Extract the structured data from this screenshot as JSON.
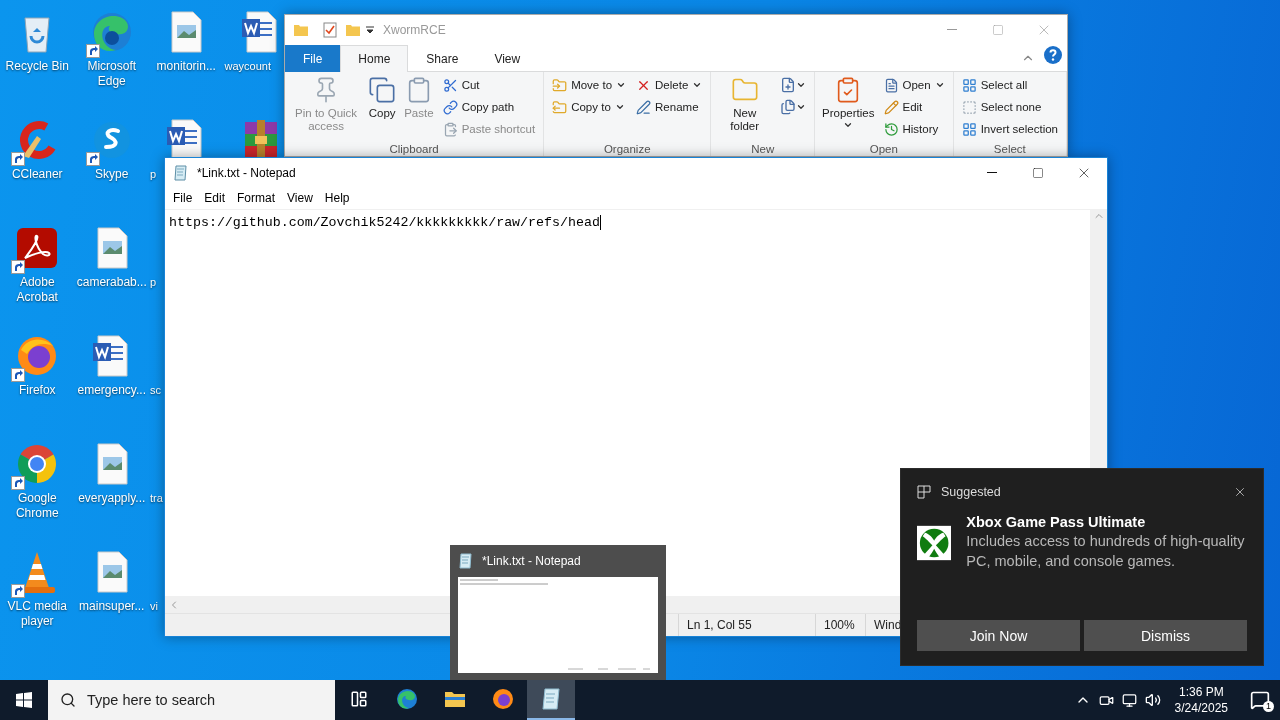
{
  "desktop_icons": [
    {
      "label": "Recycle Bin",
      "shortcut": false,
      "icon": true,
      "clipped": false
    },
    {
      "label": "CCleaner",
      "shortcut": true,
      "icon": true,
      "clipped": false
    },
    {
      "label": "Adobe Acrobat",
      "shortcut": true,
      "icon": true,
      "clipped": false
    },
    {
      "label": "Firefox",
      "shortcut": true,
      "icon": true,
      "clipped": false
    },
    {
      "label": "Google Chrome",
      "shortcut": true,
      "icon": true,
      "clipped": false
    },
    {
      "label": "VLC media player",
      "shortcut": true,
      "icon": true,
      "clipped": false
    },
    {
      "label": "Microsoft Edge",
      "shortcut": true,
      "icon": true,
      "clipped": false
    },
    {
      "label": "Skype",
      "shortcut": true,
      "icon": true,
      "clipped": false
    },
    {
      "label": "camerabab...",
      "shortcut": false,
      "icon": true,
      "clipped": false
    },
    {
      "label": "emergency...",
      "shortcut": false,
      "icon": true,
      "clipped": false
    },
    {
      "label": "everyapply...",
      "shortcut": false,
      "icon": true,
      "clipped": false
    },
    {
      "label": "mainsuper...",
      "shortcut": false,
      "icon": true,
      "clipped": false
    },
    {
      "label": "monitorin...",
      "shortcut": false,
      "icon": true,
      "clipped": false
    },
    {
      "label": "p",
      "shortcut": false,
      "icon": true,
      "clipped": true
    },
    {
      "label": "p",
      "icon": false,
      "clipped": true
    },
    {
      "label": "sc",
      "icon": false,
      "clipped": true
    },
    {
      "label": "tra",
      "icon": false,
      "clipped": true
    },
    {
      "label": "vi",
      "icon": false,
      "clipped": true
    },
    {
      "label": "waycount",
      "shortcut": false,
      "icon": true,
      "clipped": true
    },
    {
      "shortcut": false,
      "icon": true
    }
  ],
  "explorer": {
    "title": "XwormRCE",
    "active": false,
    "tabs": [
      {
        "label": "File",
        "kind": "file",
        "selected": false
      },
      {
        "label": "Home",
        "kind": "tab",
        "selected": true
      },
      {
        "label": "Share",
        "kind": "tab",
        "selected": false
      },
      {
        "label": "View",
        "kind": "tab",
        "selected": false
      }
    ],
    "groups": [
      {
        "label": "Clipboard",
        "columns": [
          [
            {
              "label": "Pin to Quick access",
              "kind": "large",
              "disabled": true,
              "dropdown": false
            }
          ],
          [
            {
              "label": "Copy",
              "kind": "large",
              "disabled": false,
              "dropdown": false
            }
          ],
          [
            {
              "label": "Paste",
              "kind": "large",
              "disabled": true,
              "dropdown": false
            }
          ],
          [
            {
              "label": "Cut",
              "kind": "small",
              "disabled": false,
              "dropdown": false
            },
            {
              "label": "Copy path",
              "kind": "small",
              "disabled": false,
              "dropdown": false
            },
            {
              "label": "Paste shortcut",
              "kind": "small",
              "disabled": true,
              "dropdown": false
            }
          ]
        ]
      },
      {
        "label": "Organize",
        "columns": [
          [
            {
              "label": "Move to",
              "kind": "small",
              "disabled": false,
              "dropdown": true
            },
            {
              "label": "Copy to",
              "kind": "small",
              "disabled": false,
              "dropdown": true
            }
          ],
          [
            {
              "label": "Delete",
              "kind": "small",
              "disabled": false,
              "dropdown": true
            },
            {
              "label": "Rename",
              "kind": "small",
              "disabled": false,
              "dropdown": false
            }
          ]
        ]
      },
      {
        "label": "New",
        "columns": [
          [
            {
              "label": "New folder",
              "kind": "large",
              "disabled": false,
              "dropdown": false
            }
          ],
          [
            {
              "kind": "icon",
              "disabled": false,
              "dropdown": true
            },
            {
              "kind": "icon",
              "disabled": false,
              "dropdown": true
            }
          ]
        ]
      },
      {
        "label": "Open",
        "columns": [
          [
            {
              "label": "Properties",
              "kind": "large",
              "disabled": false,
              "dropdown": true
            }
          ],
          [
            {
              "label": "Open",
              "kind": "small",
              "disabled": false,
              "dropdown": true
            },
            {
              "label": "Edit",
              "kind": "small",
              "disabled": false,
              "dropdown": false
            },
            {
              "label": "History",
              "kind": "small",
              "disabled": false,
              "dropdown": false
            }
          ]
        ]
      },
      {
        "label": "Select",
        "columns": [
          [
            {
              "label": "Select all",
              "kind": "small",
              "disabled": false,
              "dropdown": false
            },
            {
              "label": "Select none",
              "kind": "small",
              "disabled": false,
              "dropdown": false
            },
            {
              "label": "Invert selection",
              "kind": "small",
              "disabled": false,
              "dropdown": false
            }
          ]
        ]
      }
    ]
  },
  "notepad": {
    "title": "*Link.txt - Notepad",
    "active": true,
    "menu": [
      "File",
      "Edit",
      "Format",
      "View",
      "Help"
    ],
    "text": "https://github.com/Zovchik5242/kkkkkkkkk/raw/refs/head",
    "status": [
      "Ln 1, Col 55",
      "100%",
      "Wind"
    ]
  },
  "preview": {
    "title": "*Link.txt - Notepad"
  },
  "notification": {
    "kicker": "Suggested",
    "title": "Xbox Game Pass Ultimate",
    "body": "Includes access to hundreds of high-quality PC, mobile, and console games.",
    "buttons": [
      "Join Now",
      "Dismiss"
    ]
  },
  "taskbar": {
    "search": {
      "placeholder": "Type here to search"
    },
    "apps": [
      {
        "selected": false
      },
      {
        "selected": false
      },
      {
        "selected": false
      },
      {
        "selected": true
      }
    ],
    "time": "1:36 PM",
    "date": "3/24/2025",
    "badge": "1"
  }
}
